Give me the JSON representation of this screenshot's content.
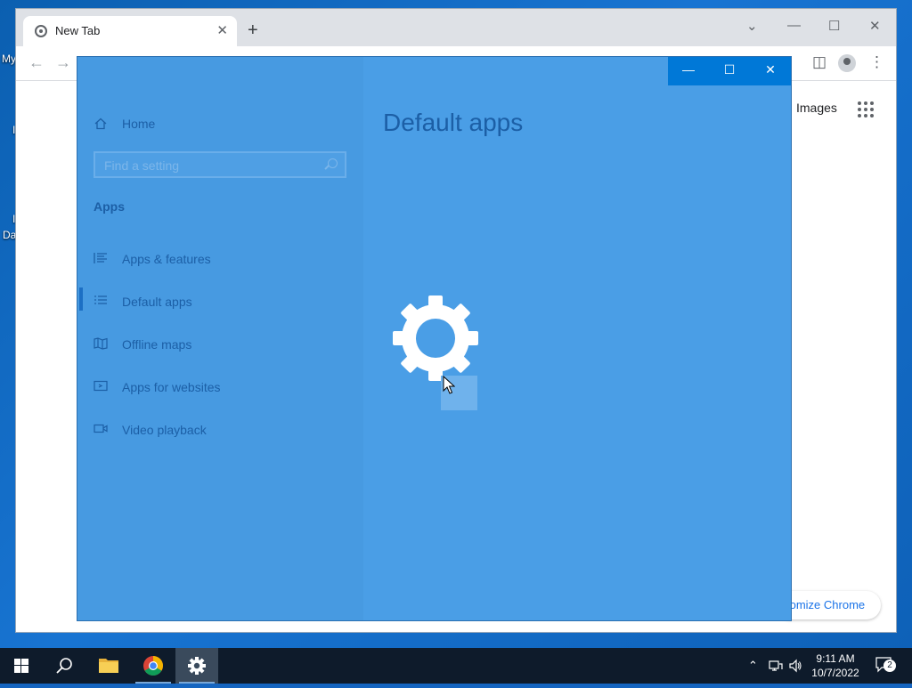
{
  "desktop": {
    "labels": [
      "My",
      "I",
      "I",
      "Da"
    ]
  },
  "chrome": {
    "tab_title": "New Tab",
    "tab_close": "✕",
    "new_tab": "+",
    "images_link": "Images",
    "customize_label": "tomize Chrome",
    "win_min": "—",
    "win_max": "☐",
    "win_close": "✕",
    "win_chevron": "⌄"
  },
  "settings": {
    "home_label": "Home",
    "search_placeholder": "Find a setting",
    "section": "Apps",
    "nav_items": [
      {
        "label": "Apps & features",
        "icon": "apps-features-icon"
      },
      {
        "label": "Default apps",
        "icon": "default-apps-icon"
      },
      {
        "label": "Offline maps",
        "icon": "offline-maps-icon"
      },
      {
        "label": "Apps for websites",
        "icon": "apps-websites-icon"
      },
      {
        "label": "Video playback",
        "icon": "video-playback-icon"
      }
    ],
    "selected_item": "Default apps",
    "page_title": "Default apps",
    "win_min": "—",
    "win_max": "☐",
    "win_close": "✕"
  },
  "taskbar": {
    "time": "9:11 AM",
    "date": "10/7/2022",
    "notification_count": "2"
  },
  "colors": {
    "settings_bg": "#4a9ee6",
    "accent": "#0078d7",
    "taskbar": "#0e1b2b"
  }
}
